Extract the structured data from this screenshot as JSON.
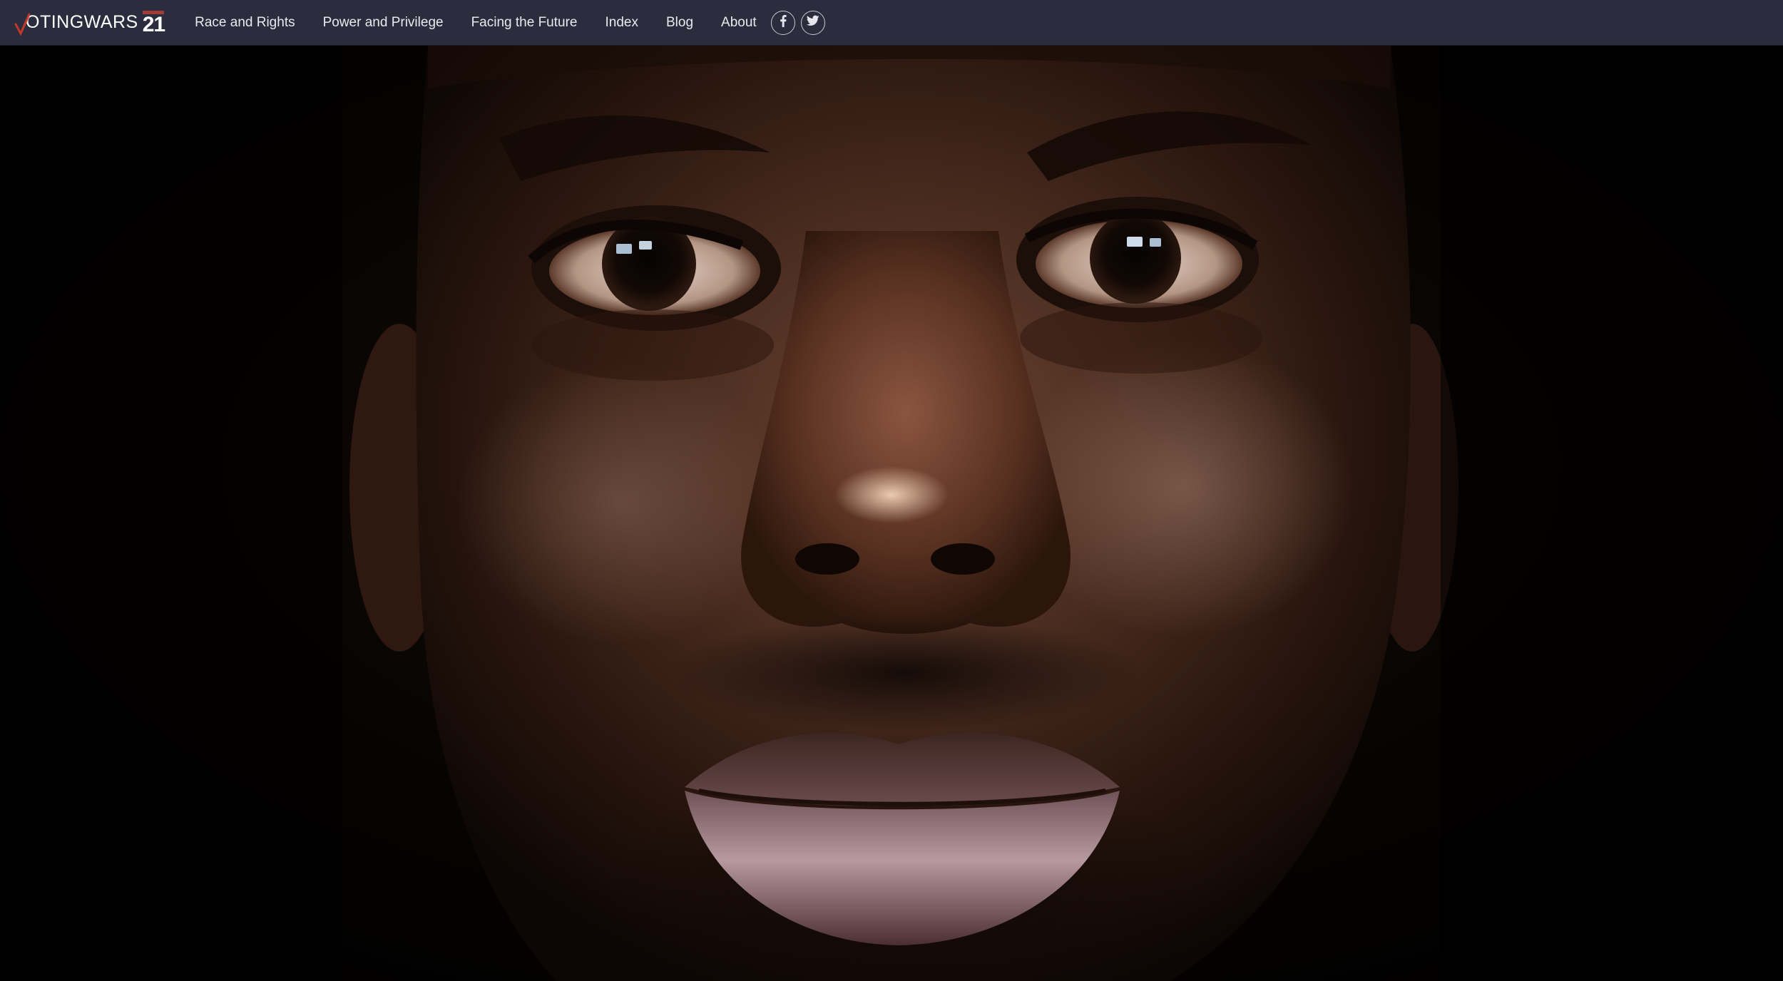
{
  "site": {
    "logo_text": "OTINGWARS",
    "logo_number": "21"
  },
  "nav": {
    "items": [
      {
        "label": "Race and Rights"
      },
      {
        "label": "Power and Privilege"
      },
      {
        "label": "Facing the Future"
      },
      {
        "label": "Index"
      },
      {
        "label": "Blog"
      },
      {
        "label": "About"
      }
    ]
  },
  "social": {
    "facebook_icon": "facebook-icon",
    "twitter_icon": "twitter-icon"
  },
  "hero": {
    "image_subject": "portrait-photo"
  },
  "colors": {
    "topbar_bg": "#2b2c3e",
    "logo_accent": "#c0392b",
    "nav_text": "#e9e9ee"
  }
}
